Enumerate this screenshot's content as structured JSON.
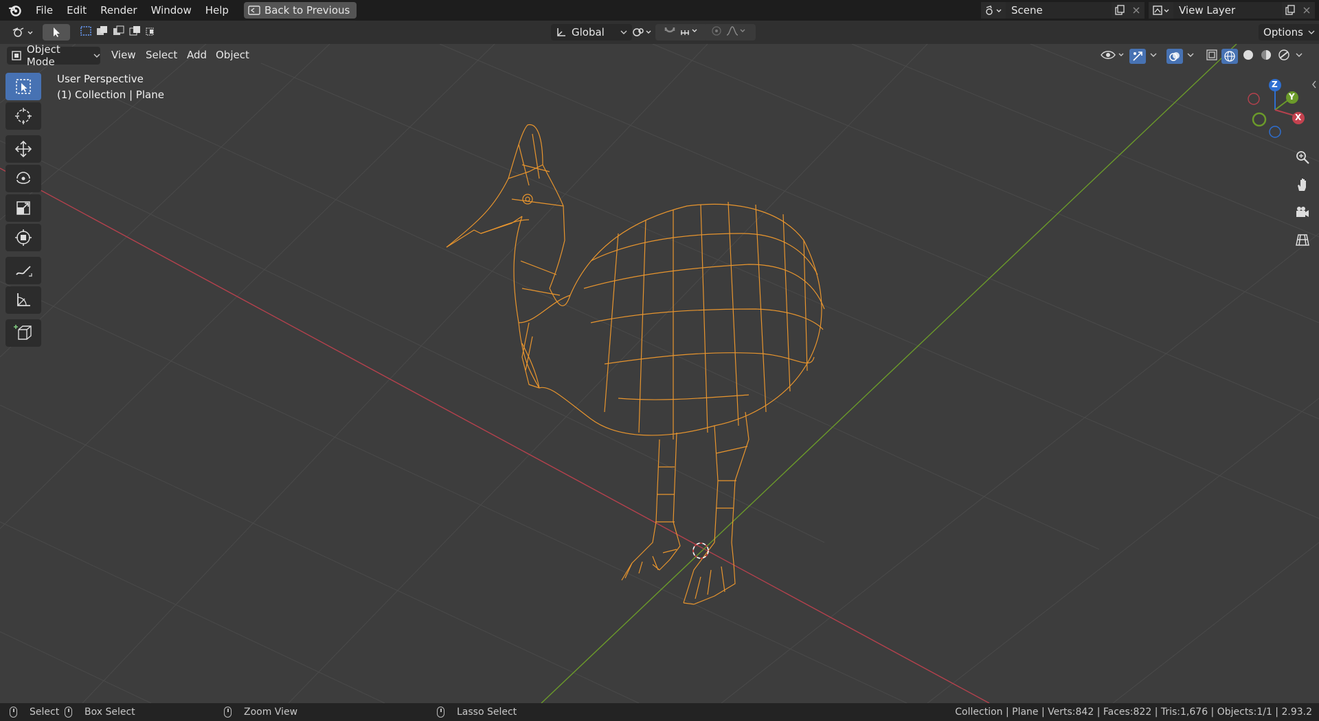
{
  "menubar": {
    "items": [
      "File",
      "Edit",
      "Render",
      "Window",
      "Help"
    ],
    "back_label": "Back to Previous",
    "scene": "Scene",
    "view_layer": "View Layer"
  },
  "toolheader": {
    "orientation": "Global",
    "options_label": "Options"
  },
  "viewport_header": {
    "mode": "Object Mode",
    "menus": [
      "View",
      "Select",
      "Add",
      "Object"
    ]
  },
  "overlay": {
    "perspective": "User Perspective",
    "collection": "(1) Collection | Plane"
  },
  "gizmo": {
    "x": "X",
    "y": "Y",
    "z": "Z"
  },
  "statusbar": {
    "select": "Select",
    "box_select": "Box Select",
    "zoom_view": "Zoom View",
    "lasso_select": "Lasso Select",
    "stats": "Collection | Plane | Verts:842 | Faces:822 | Tris:1,676 | Objects:1/1 | 2.93.2"
  },
  "colors": {
    "x_axis": "#b5414d",
    "y_axis": "#6b9a2a",
    "wire": "#e8952e",
    "accent": "#4772b3"
  }
}
